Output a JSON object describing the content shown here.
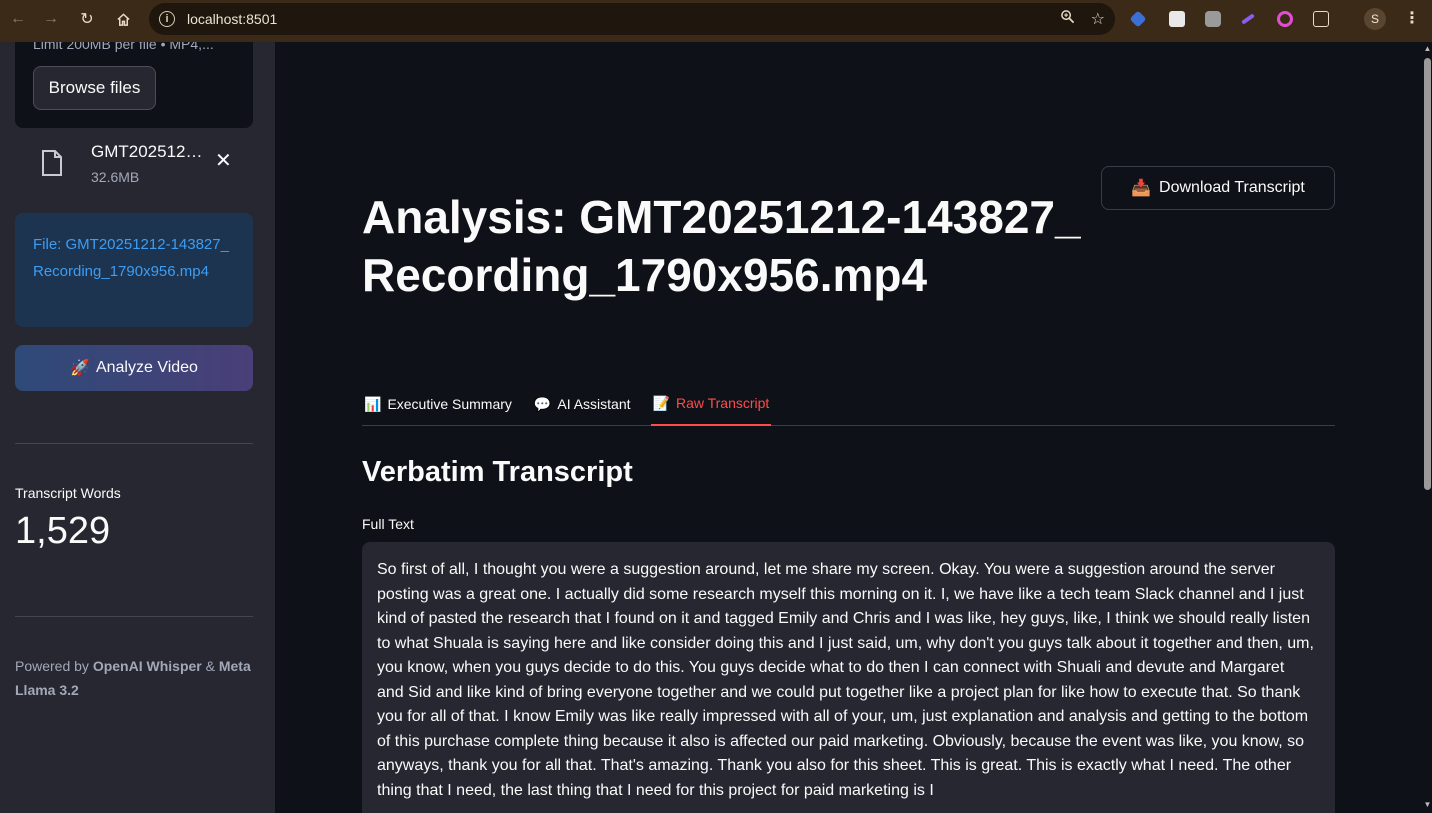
{
  "browser": {
    "url": "localhost:8501",
    "profile_initial": "S"
  },
  "sidebar": {
    "upload_limit_text": "Limit 200MB per file • MP4,...",
    "browse_label": "Browse files",
    "file_name": "GMT20251212-143827_Recording_1790x956.mp4",
    "file_size": "32.6MB",
    "info_text": "File: GMT20251212-143827_Recording_1790x956.mp4",
    "analyze_label": "Analyze Video",
    "metric_label": "Transcript Words",
    "metric_value": "1,529",
    "powered_prefix": "Powered by ",
    "powered_a": "OpenAI Whisper",
    "powered_amp": " & ",
    "powered_b": "Meta Llama 3.2"
  },
  "main": {
    "download_label": "Download Transcript",
    "title": "Analysis: GMT20251212-143827_Recording_1790x956.mp4",
    "tabs": [
      {
        "label": "Executive Summary",
        "icon": "bar-chart-icon",
        "active": false
      },
      {
        "label": "AI Assistant",
        "icon": "speech-bubble-icon",
        "active": false
      },
      {
        "label": "Raw Transcript",
        "icon": "memo-icon",
        "active": true
      }
    ],
    "section_heading": "Verbatim Transcript",
    "field_label": "Full Text",
    "transcript": " So first of all, I thought you were a suggestion around, let me share my screen. Okay. You were a suggestion around the server posting was a great one. I actually did some research myself this morning on it. I, we have like a tech team Slack channel and I just kind of pasted the research that I found on it and tagged Emily and Chris and I was like, hey guys, like, I think we should really listen to what Shuala is saying here and like consider doing this and I just said, um, why don't you guys talk about it together and then, um, you know, when you guys decide to do this. You guys decide what to do then I can connect with Shuali and devute and Margaret and Sid and like kind of bring everyone together and we could put together like a project plan for like how to execute that. So thank you for all of that. I know Emily was like really impressed with all of your, um, just explanation and analysis and getting to the bottom of this purchase complete thing because it also is affected our paid marketing. Obviously, because the event was like, you know, so anyways, thank you for all that. That's amazing. Thank you also for this sheet. This is great. This is exactly what I need. The other thing that I need, the last thing that I need for this project for paid marketing is I"
  },
  "colors": {
    "accent": "#ff4b4b",
    "info_text": "#3d9df3",
    "background": "#0e1117",
    "sidebar": "#262730"
  }
}
